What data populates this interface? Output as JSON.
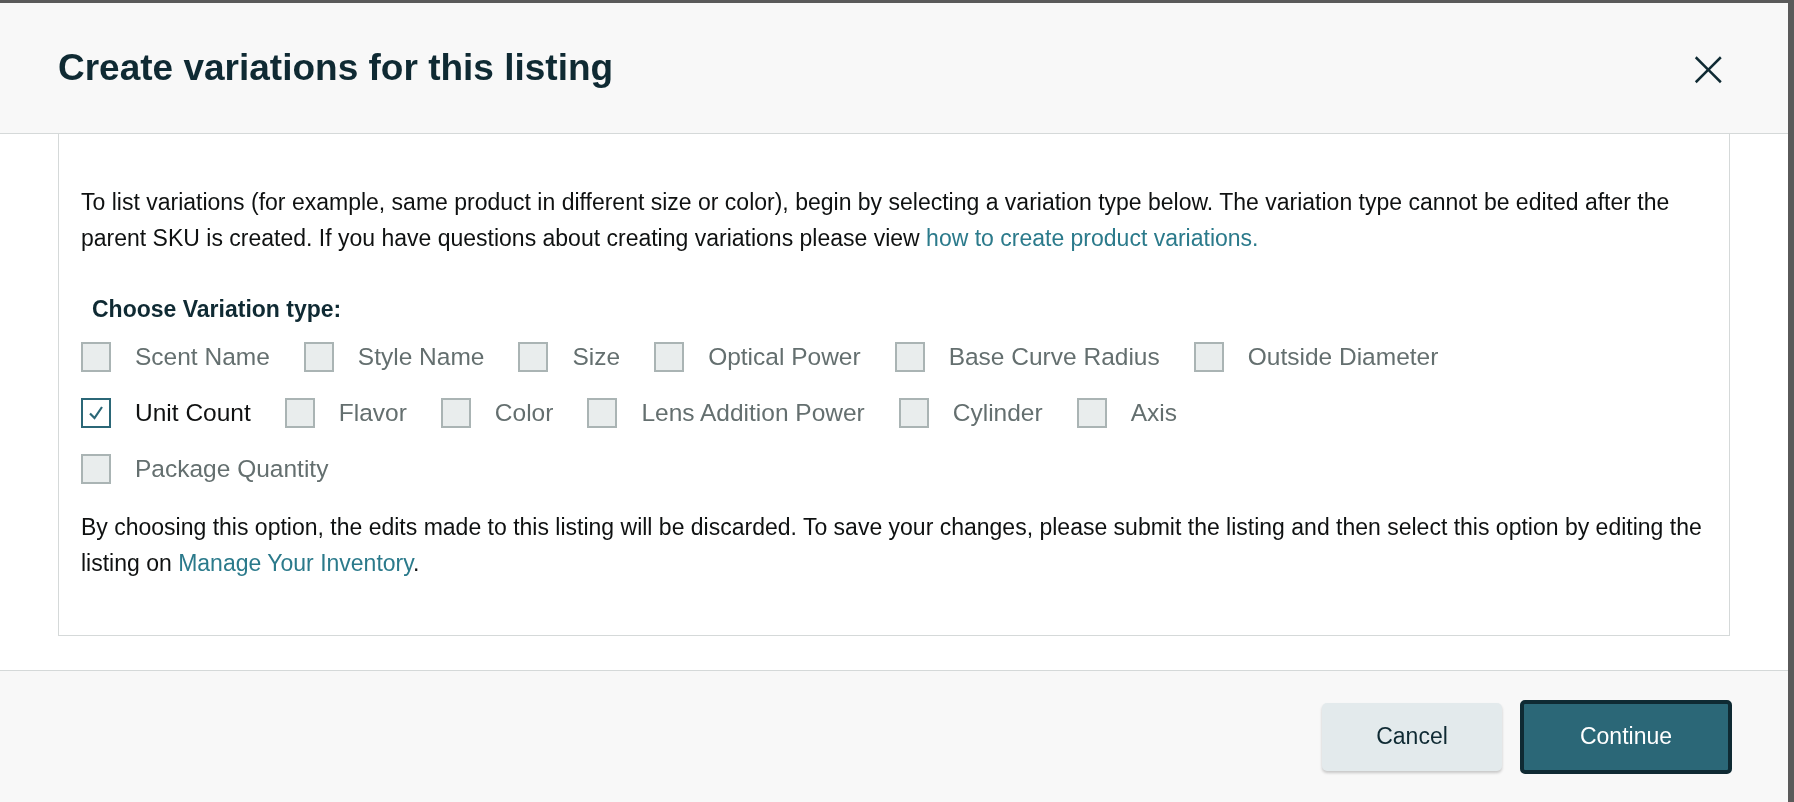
{
  "dialog": {
    "title": "Create variations for this listing",
    "close": "×"
  },
  "intro": {
    "text": "To list variations (for example, same product in different size or color), begin by selecting a variation type below. The variation type cannot be edited after the parent SKU is created. If you have questions about creating variations please view",
    "link": "how to create product variations."
  },
  "variation_heading": "Choose Variation type:",
  "variation_rows": [
    [
      {
        "label": "Scent Name",
        "checked": false
      },
      {
        "label": "Style Name",
        "checked": false
      },
      {
        "label": "Size",
        "checked": false
      },
      {
        "label": "Optical Power",
        "checked": false
      },
      {
        "label": "Base Curve Radius",
        "checked": false
      },
      {
        "label": "Outside Diameter",
        "checked": false
      }
    ],
    [
      {
        "label": "Unit Count",
        "checked": true
      },
      {
        "label": "Flavor",
        "checked": false
      },
      {
        "label": "Color",
        "checked": false
      },
      {
        "label": "Lens Addition Power",
        "checked": false
      },
      {
        "label": "Cylinder",
        "checked": false
      },
      {
        "label": "Axis",
        "checked": false
      }
    ],
    [
      {
        "label": "Package Quantity",
        "checked": false
      }
    ]
  ],
  "notice": {
    "text": "By choosing this option, the edits made to this listing will be discarded. To save your changes, please submit the listing and then select this option by editing the listing on",
    "link": "Manage Your Inventory",
    "after": "."
  },
  "buttons": [
    {
      "label": "Cancel",
      "kind": "secondary"
    },
    {
      "label": "Continue",
      "kind": "primary"
    }
  ]
}
